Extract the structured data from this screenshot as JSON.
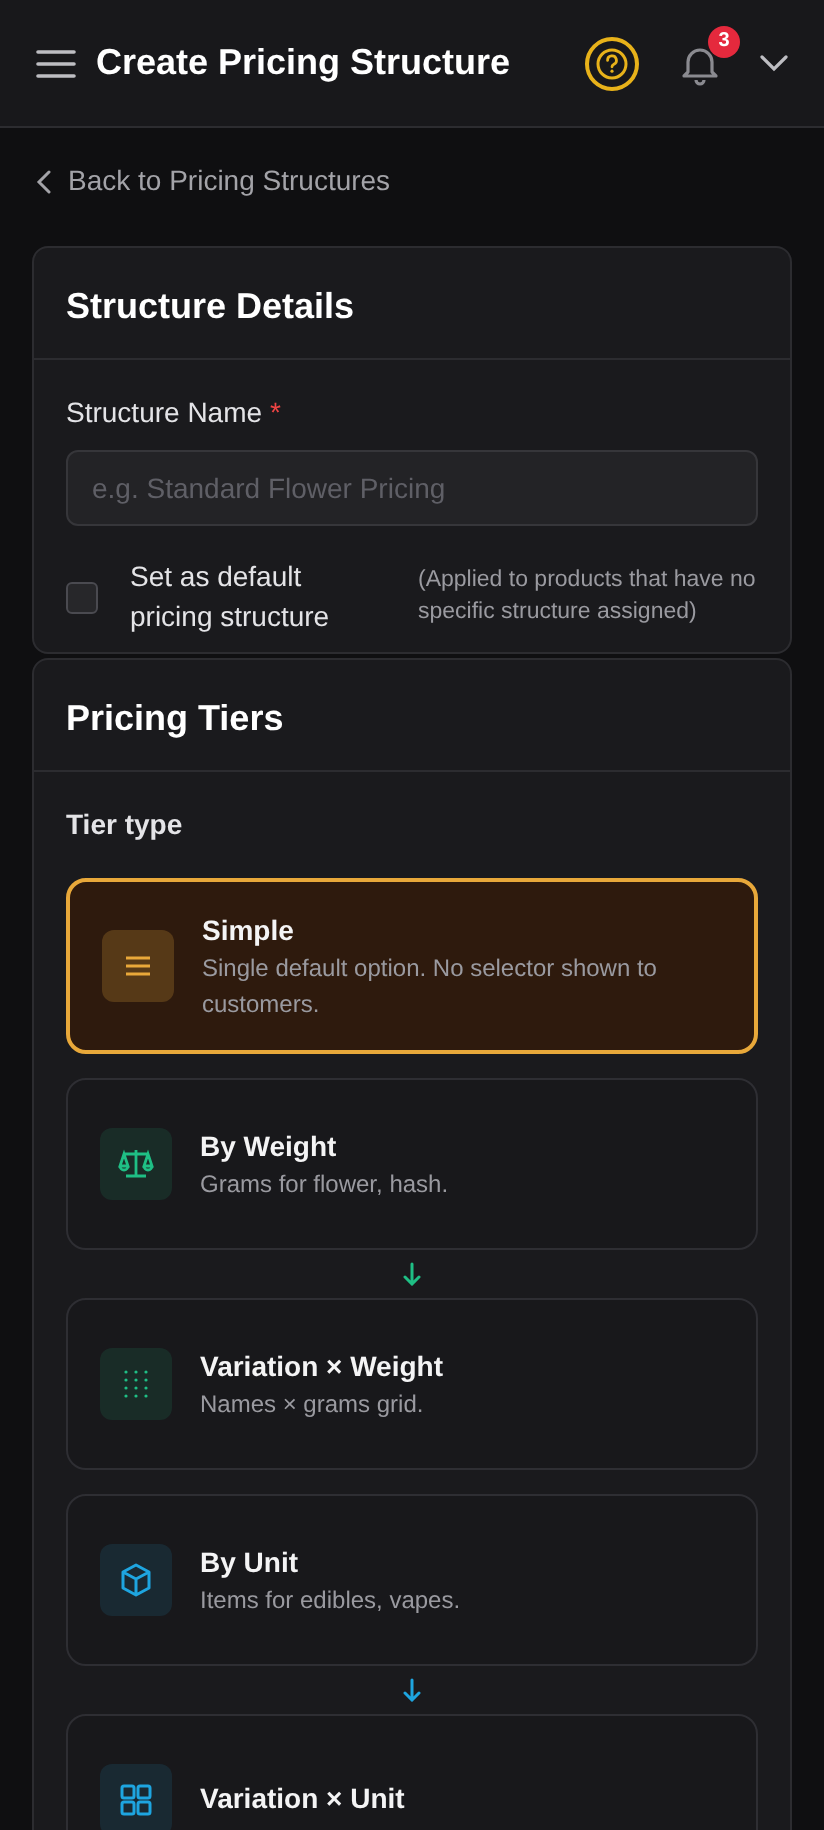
{
  "header": {
    "title": "Create Pricing Structure",
    "notification_count": "3"
  },
  "back_link": "Back to Pricing Structures",
  "structure_details": {
    "title": "Structure Details",
    "name_label": "Structure Name",
    "required_mark": "*",
    "name_placeholder": "e.g. Standard Flower Pricing",
    "default_checkbox": {
      "label": "Set as default pricing structure",
      "checked": false,
      "hint": "(Applied to products that have no specific structure assigned)"
    }
  },
  "pricing_tiers": {
    "title": "Pricing Tiers",
    "tier_type_label": "Tier type",
    "options": [
      {
        "kind": "lines",
        "name": "Simple",
        "description": "Single default option. No selector shown to customers.",
        "selected": true,
        "color": "#e8a83a",
        "arrow_after": false
      },
      {
        "kind": "scale",
        "name": "By Weight",
        "description": "Grams for flower, hash.",
        "selected": false,
        "color": "#1fbf85",
        "arrow_after": true
      },
      {
        "kind": "dots",
        "name": "Variation × Weight",
        "description": "Names × grams grid.",
        "selected": false,
        "color": "#1fbf85",
        "arrow_after": false
      },
      {
        "kind": "cube",
        "name": "By Unit",
        "description": "Items for edibles, vapes.",
        "selected": false,
        "color": "#1ea5e0",
        "arrow_after": true
      },
      {
        "kind": "grid",
        "name": "Variation × Unit",
        "selected": false,
        "color": "#1ea5e0",
        "arrow_after": false
      }
    ]
  }
}
